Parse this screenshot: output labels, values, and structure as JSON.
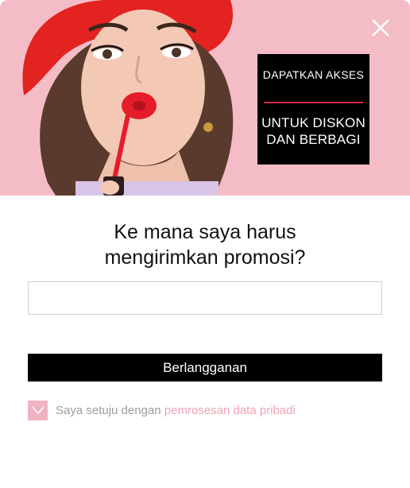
{
  "hero": {
    "image_description": "woman-applying-red-lipstick",
    "background_color": "#f2b7c2",
    "promo": {
      "line1": "DAPATKAN AKSES",
      "line2": "UNTUK DISKON DAN BERBAGI",
      "accent_color": "#d3244a"
    },
    "close_icon": "close-icon"
  },
  "form": {
    "heading": "Ke mana saya harus mengirimkan promosi?",
    "email_value": "",
    "email_placeholder": "",
    "subscribe_label": "Berlangganan",
    "consent": {
      "checked": true,
      "text": "Saya setuju dengan",
      "link_text": "pemrosesan data pribadi",
      "checkbox_color": "#f0b3c0",
      "link_color": "#f2a2b4"
    }
  }
}
